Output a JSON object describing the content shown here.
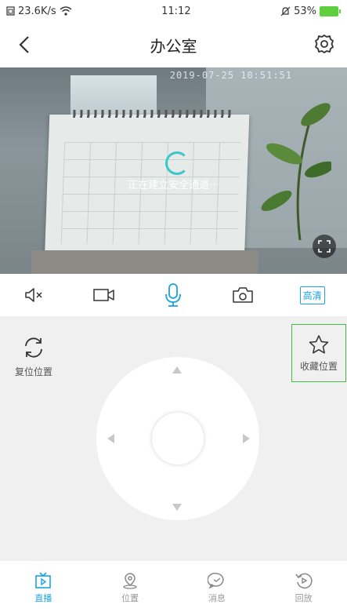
{
  "status_bar": {
    "net_speed": "23.6K/s",
    "time": "11:12",
    "battery": "53%"
  },
  "header": {
    "title": "办公室",
    "back_icon": "back-chevron-icon",
    "settings_icon": "gear-icon"
  },
  "video": {
    "timestamp": "2019-07-25 10:51:51",
    "loading_text": "正在建立安全通道···"
  },
  "toolbar": {
    "mute_icon": "speaker-mute-icon",
    "record_icon": "video-record-icon",
    "mic_icon": "microphone-icon",
    "snapshot_icon": "camera-icon",
    "quality_label": "高清"
  },
  "controls": {
    "reset_label": "复位位置",
    "favorite_label": "收藏位置"
  },
  "tabs": [
    {
      "label": "直播",
      "icon": "tv-play-icon"
    },
    {
      "label": "位置",
      "icon": "location-pin-icon"
    },
    {
      "label": "消息",
      "icon": "message-icon"
    },
    {
      "label": "回放",
      "icon": "playback-icon"
    }
  ],
  "colors": {
    "accent": "#1aa3e6",
    "spinner": "#38c8c8",
    "favorite_border": "#3fbf4a"
  }
}
